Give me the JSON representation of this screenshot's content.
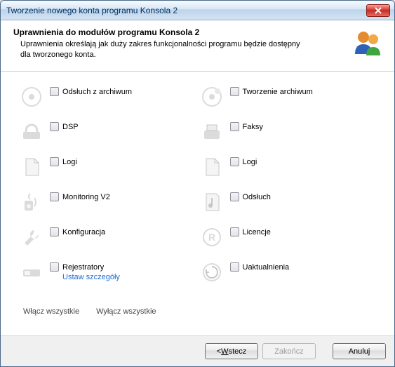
{
  "window": {
    "title": "Tworzenie nowego konta programu Konsola 2"
  },
  "header": {
    "title": "Uprawnienia do modułów programu Konsola 2",
    "description": "Uprawnienia określają jak duży zakres funkcjonalności programu będzie dostępny dla tworzonego konta."
  },
  "permissions": {
    "left": [
      {
        "id": "archive-listen",
        "label": "Odsłuch z archiwum",
        "icon": "disc"
      },
      {
        "id": "dsp",
        "label": "DSP",
        "icon": "phone"
      },
      {
        "id": "logs-left",
        "label": "Logi",
        "icon": "page"
      },
      {
        "id": "monitoring",
        "label": "Monitoring V2",
        "icon": "speaker"
      },
      {
        "id": "config",
        "label": "Konfiguracja",
        "icon": "wrench"
      },
      {
        "id": "recorders",
        "label": "Rejestratory",
        "icon": "device",
        "link": "Ustaw szczegóły"
      }
    ],
    "right": [
      {
        "id": "archive-create",
        "label": "Tworzenie archiwum",
        "icon": "disc-burn"
      },
      {
        "id": "fax",
        "label": "Faksy",
        "icon": "fax"
      },
      {
        "id": "logs-right",
        "label": "Logi",
        "icon": "page"
      },
      {
        "id": "listen",
        "label": "Odsłuch",
        "icon": "note"
      },
      {
        "id": "licenses",
        "label": "Licencje",
        "icon": "registered"
      },
      {
        "id": "updates",
        "label": "Uaktualnienia",
        "icon": "refresh"
      }
    ]
  },
  "toggles": {
    "enable_all": "Włącz wszystkie",
    "disable_all": "Wyłącz wszystkie"
  },
  "buttons": {
    "back": "< Wstecz",
    "finish": "Zakończ",
    "cancel": "Anuluj"
  }
}
